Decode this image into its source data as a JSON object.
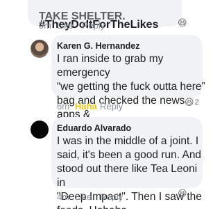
{
  "comments": [
    {
      "text_lines": [
        "TAKE SHELTER.",
        "#TheyDoItForTheLikes"
      ],
      "actions": {
        "time": "9m",
        "like": "Like",
        "reply": "Reply"
      },
      "reaction": {
        "emoji": "😆",
        "count": ""
      }
    },
    {
      "author": "Karen G. Hernandez",
      "text": "I ran inside to grab my emergency\n“we getting the fuck outta here”\nbag and checked the news apps &\ntwitter to find the scoop.",
      "actions": {
        "time": "6m",
        "like": "Haha",
        "reply": "Reply"
      },
      "reaction": {
        "emoji": "😆",
        "count": "2"
      },
      "like_color": "#f0c419"
    },
    {
      "author": "Eduardo Alvarado",
      "text": "I was in the middle of a joint. I\nsaid, it's been a good run. And\nstood out there like Tea Leoni in\n\"Deep Impact\". Then I saw the\nfeeds. Hahaha",
      "actions": {
        "time": "4m",
        "like": "Like",
        "reply": "Reply"
      },
      "reaction": {
        "emoji": "😆",
        "count": ""
      }
    }
  ],
  "colors": {
    "bubble": "#f0f2f5",
    "meta": "#8d949e",
    "haha": "#f0c419"
  }
}
